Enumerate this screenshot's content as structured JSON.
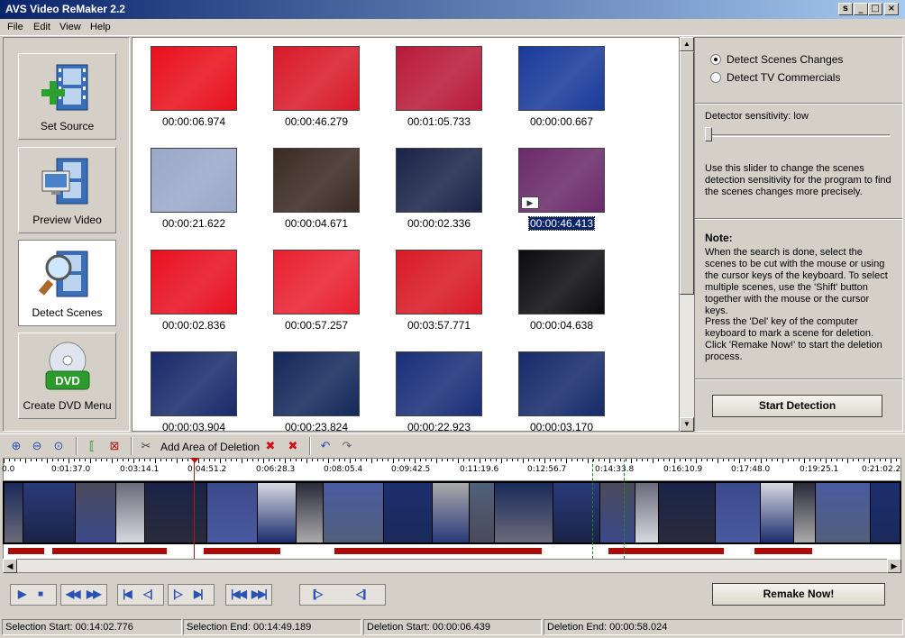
{
  "window": {
    "title": "AVS Video ReMaker 2.2",
    "controls": [
      "s",
      "_",
      "□",
      "×"
    ]
  },
  "menu": [
    "File",
    "Edit",
    "View",
    "Help"
  ],
  "nav": [
    {
      "label": "Set Source",
      "icon": "film-add-icon",
      "active": false
    },
    {
      "label": "Preview Video",
      "icon": "film-preview-icon",
      "active": false
    },
    {
      "label": "Detect Scenes",
      "icon": "film-magnifier-icon",
      "active": true
    },
    {
      "label": "Create DVD Menu",
      "icon": "dvd-disc-icon",
      "active": false
    }
  ],
  "thumbnails": [
    {
      "time": "00:00:06.974",
      "tint": "#e8101c"
    },
    {
      "time": "00:00:46.279",
      "tint": "#d81a2a"
    },
    {
      "time": "00:01:05.733",
      "tint": "#b81a3a"
    },
    {
      "time": "00:00:00.667",
      "tint": "#1a3a9a"
    },
    {
      "time": "00:00:21.622",
      "tint": "#9aa8c8"
    },
    {
      "time": "00:00:04.671",
      "tint": "#3a2a22"
    },
    {
      "time": "00:00:02.336",
      "tint": "#1a2448"
    },
    {
      "time": "00:00:46.413",
      "tint": "#6a2a6a",
      "selected": true
    },
    {
      "time": "00:00:02.836",
      "tint": "#e81020"
    },
    {
      "time": "00:00:57.257",
      "tint": "#e82030"
    },
    {
      "time": "00:03:57.771",
      "tint": "#d81a24"
    },
    {
      "time": "00:00:04.638",
      "tint": "#0c0c10"
    },
    {
      "time": "00:00:03.904",
      "tint": "#1a2a6a"
    },
    {
      "time": "00:00:23.824",
      "tint": "#14285a"
    },
    {
      "time": "00:00:22.923",
      "tint": "#1a2e78"
    },
    {
      "time": "00:00:03.170",
      "tint": "#162a6a"
    }
  ],
  "right_panel": {
    "radio_scenes": "Detect Scenes Changes",
    "radio_commercials": "Detect TV Commercials",
    "sensitivity_label": "Detector sensitivity: low",
    "sensitivity_value": 0,
    "slider_help": "Use this slider to change the scenes detection sensitivity for the program to find the scenes changes more precisely.",
    "note_title": "Note:",
    "note_text_1": "When the search is done, select the scenes to be cut with the mouse or using the cursor keys of the keyboard. To select multiple scenes, use the 'Shift' button together with the mouse or the cursor keys.",
    "note_text_2": "Press the 'Del' key of the computer keyboard to mark a scene for deletion. Click 'Remake Now!' to start the deletion process.",
    "start_button": "Start Detection"
  },
  "toolbar": {
    "add_deletion": "Add Area of Deletion"
  },
  "ruler_labels": [
    "0.0",
    "0:01:37.0",
    "0:03:14.1",
    "0:04:51.2",
    "0:06:28.3",
    "0:08:05.4",
    "0:09:42.5",
    "0:11:19.6",
    "0:12:56.7",
    "0:14:33.8",
    "0:16:10.9",
    "0:17:48.0",
    "0:19:25.1",
    "0:21:02.2"
  ],
  "remake_button": "Remake Now!",
  "status": {
    "selection_start": "Selection Start: 00:14:02.776",
    "selection_end": "Selection End: 00:14:49.189",
    "deletion_start": "Deletion Start: 00:00:06.439",
    "deletion_end": "Deletion End: 00:00:58.024"
  },
  "colors": {
    "titlebar": "#0a246a",
    "deletion_marker": "#aa0a0a",
    "selection": "#0a246a"
  }
}
